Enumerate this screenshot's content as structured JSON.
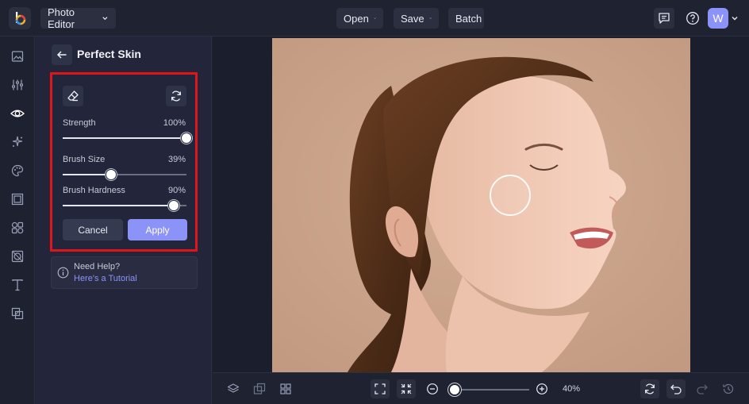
{
  "topbar": {
    "editor_label": "Photo Editor",
    "open_label": "Open",
    "save_label": "Save",
    "batch_label": "Batch",
    "avatar_initial": "W"
  },
  "panel": {
    "title": "Perfect Skin",
    "sliders": [
      {
        "label": "Strength",
        "value_text": "100%",
        "value": 100
      },
      {
        "label": "Brush Size",
        "value_text": "39%",
        "value": 39
      },
      {
        "label": "Brush Hardness",
        "value_text": "90%",
        "value": 90
      }
    ],
    "cancel_label": "Cancel",
    "apply_label": "Apply",
    "help_question": "Need Help?",
    "help_link": "Here's a Tutorial"
  },
  "bottombar": {
    "zoom_text": "40%",
    "zoom_value": 0
  },
  "colors": {
    "accent": "#8b93f8",
    "highlight_border": "#e0151b",
    "background": "#1e2130"
  }
}
